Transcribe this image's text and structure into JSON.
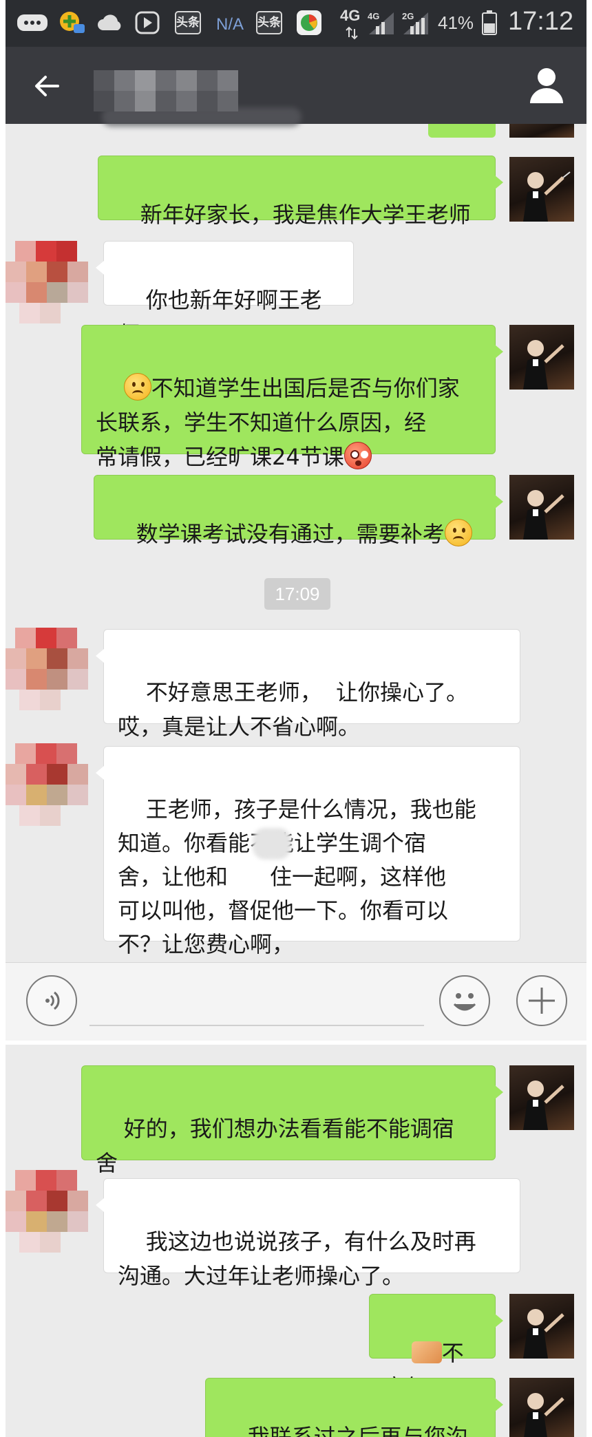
{
  "status_bar": {
    "network_na": "N/A",
    "toutiao_1": "头条",
    "toutiao_2": "头条",
    "network_4g_main": "4G",
    "network_4g_small": "4G",
    "network_2g_small": "2G",
    "battery": "41%",
    "time": "17:12"
  },
  "header": {
    "back_icon": "arrow-left",
    "profile_icon": "person",
    "contact_name_blurred": true
  },
  "messages": [
    {
      "side": "right",
      "text": "新年好家长，我是焦作大学王老师"
    },
    {
      "side": "left",
      "text": "你也新年好啊王老师"
    },
    {
      "side": "right",
      "text_a": "不知道学生出国后是否与你们家\n长联系，学生不知道什么原因，经\n常请假，已经旷课24节课",
      "emoji_start": "sad-face",
      "emoji_end": "shocked-face"
    },
    {
      "side": "right",
      "text": "数学课考试没有通过，需要补考",
      "emoji_end": "sad-face"
    },
    {
      "side": "left",
      "text": "不好意思王老师，  让你操心了。\n哎，真是让人不省心啊。"
    },
    {
      "side": "left",
      "text": "王老师，孩子是什么情况，我也能\n知道。你看能不能让学生调个宿\n舍，让他和      住一起啊，这样他\n可以叫他，督促他一下。你看可以\n不？让您费心啊，"
    },
    {
      "side": "right",
      "text": "好的，我们想办法看看能不能调宿\n舍"
    },
    {
      "side": "left",
      "text": "我这边也说说孩子，有什么及时再\n沟通。大过年让老师操心了。"
    },
    {
      "side": "right",
      "text": "不客气",
      "emoji_start": "handshake"
    },
    {
      "side": "right",
      "text": "我联系过之后再与您沟通"
    }
  ],
  "timestamp": "17:09",
  "input_bar": {
    "voice_icon": "voice-wave",
    "emoji_icon": "smiley",
    "plus_icon": "plus"
  },
  "colors": {
    "sent_bubble": "#9fe65e",
    "received_bubble": "#ffffff",
    "chat_background": "#ebebeb",
    "title_bar": "#393a3f"
  }
}
